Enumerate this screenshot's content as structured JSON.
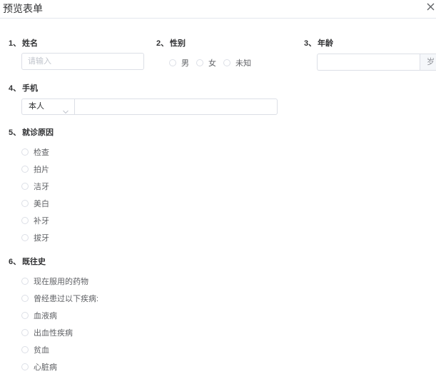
{
  "dialog": {
    "title": "预览表单",
    "close_icon": "close-icon"
  },
  "questions": {
    "q1": {
      "num": "1、",
      "label": "姓名",
      "placeholder": "请输入"
    },
    "q2": {
      "num": "2、",
      "label": "性别",
      "options": [
        "男",
        "女",
        "未知"
      ]
    },
    "q3": {
      "num": "3、",
      "label": "年龄",
      "suffix": "岁"
    },
    "q4": {
      "num": "4、",
      "label": "手机",
      "select_value": "本人"
    },
    "q5": {
      "num": "5、",
      "label": "就诊原因",
      "options": [
        "检查",
        "拍片",
        "洁牙",
        "美白",
        "补牙",
        "拔牙"
      ]
    },
    "q6": {
      "num": "6、",
      "label": "既往史",
      "options": [
        "现在服用的药物",
        "曾经患过以下疾病:",
        "血液病",
        "出血性疾病",
        "贫血",
        "心脏病"
      ]
    }
  }
}
